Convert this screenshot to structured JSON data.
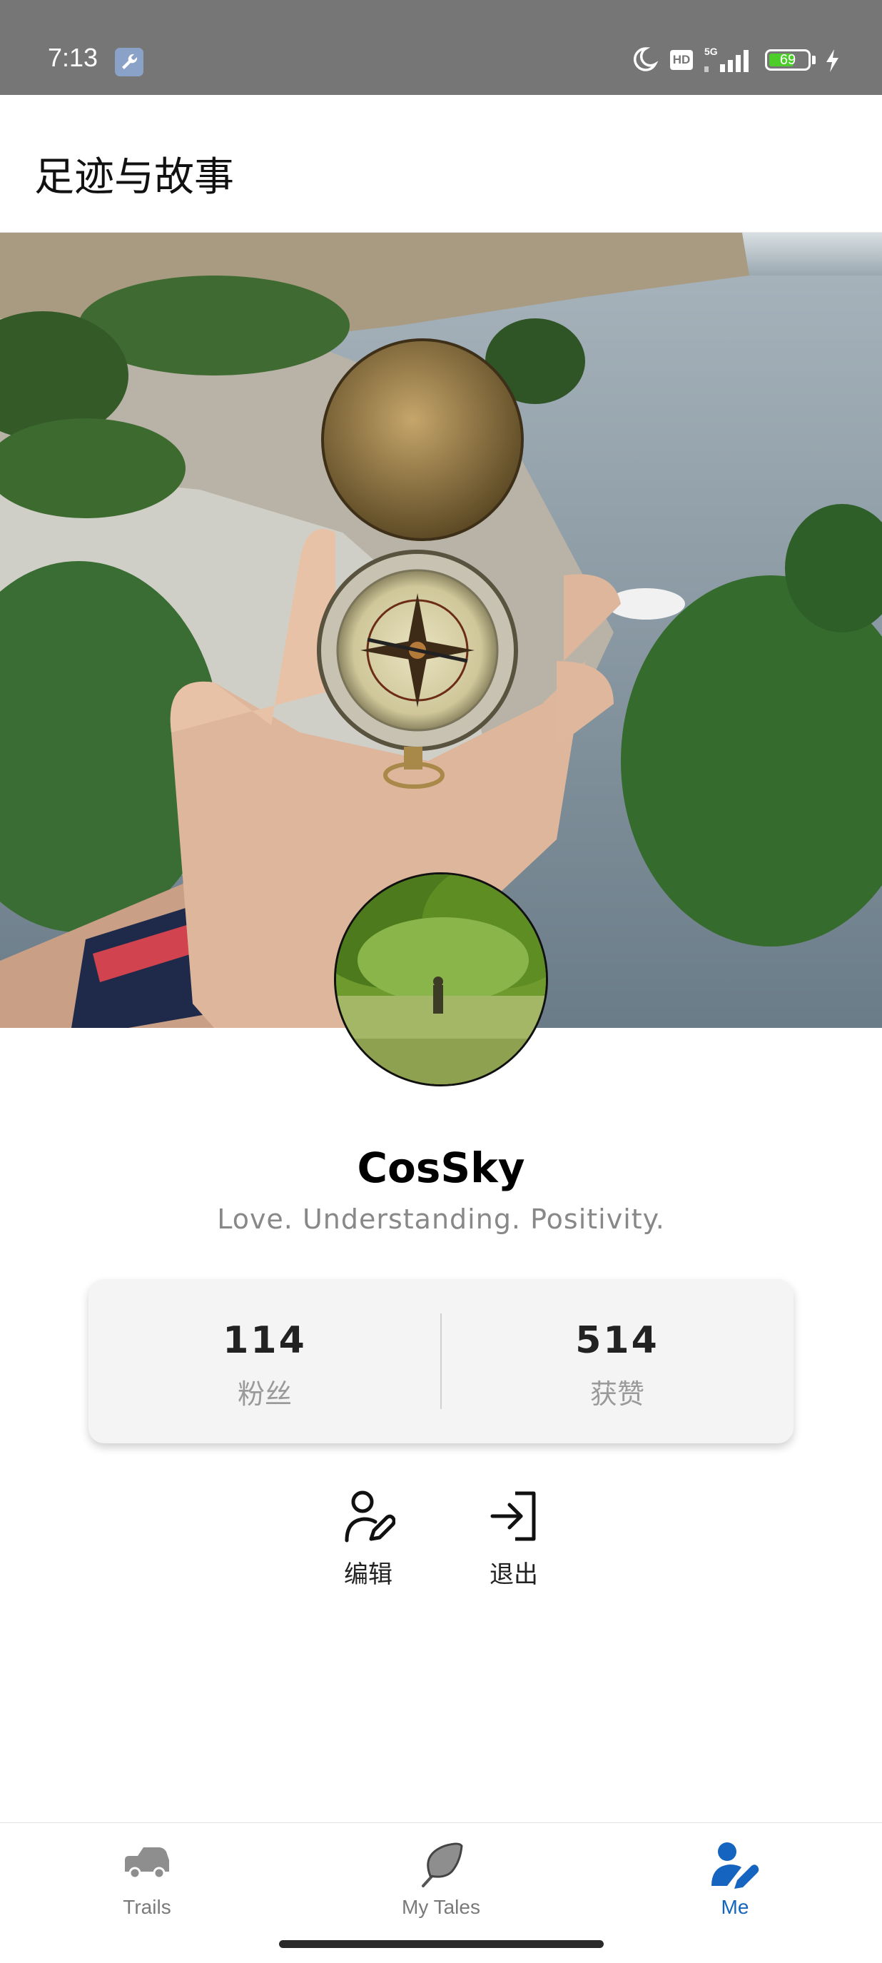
{
  "status_bar": {
    "time": "7:13",
    "network": "5G",
    "hd": "HD",
    "battery": "69",
    "battery_level": 0.69
  },
  "app_bar": {
    "title": "足迹与故事"
  },
  "profile": {
    "username": "CosSky",
    "bio": "Love. Understanding. Positivity."
  },
  "stats": [
    {
      "value": "114",
      "label": "粉丝"
    },
    {
      "value": "514",
      "label": "获赞"
    }
  ],
  "actions": {
    "edit_label": "编辑",
    "logout_label": "退出"
  },
  "bottom_nav": {
    "items": [
      {
        "label": "Trails",
        "icon": "car-icon"
      },
      {
        "label": "My Tales",
        "icon": "feather-icon"
      },
      {
        "label": "Me",
        "icon": "user-edit-icon"
      }
    ],
    "active_index": 2
  },
  "colors": {
    "status_bar_bg": "#767676",
    "accent": "#1565c0",
    "battery_green": "#4ccd2a"
  }
}
